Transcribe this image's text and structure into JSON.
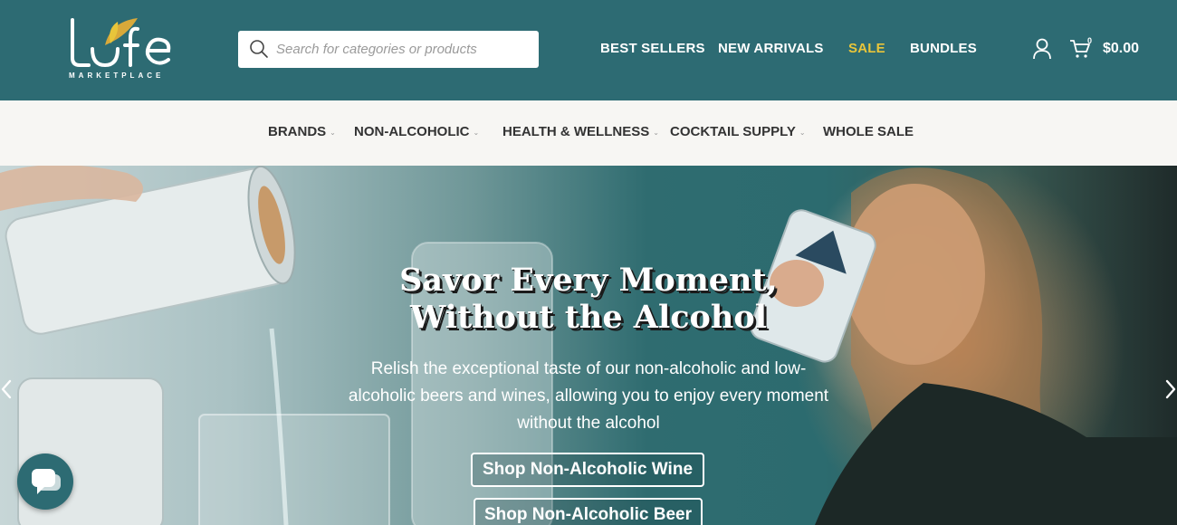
{
  "brand": {
    "logo_text": "MARKETPLACE",
    "colors": {
      "header_bg": "#2d6b73",
      "sale": "#e8c53a",
      "logo_gold": "#d9a93a"
    }
  },
  "search": {
    "placeholder": "Search for categories or products"
  },
  "main_nav": [
    {
      "label": "BEST SELLERS"
    },
    {
      "label": "NEW ARRIVALS"
    },
    {
      "label": "SALE"
    },
    {
      "label": "BUNDLES"
    }
  ],
  "cart": {
    "count": "0",
    "total": "$0.00"
  },
  "categories": [
    {
      "label": "BRANDS"
    },
    {
      "label": "NON-ALCOHOLIC"
    },
    {
      "label": "HEALTH & WELLNESS"
    },
    {
      "label": "COCKTAIL SUPPLY"
    },
    {
      "label": "WHOLE SALE"
    }
  ],
  "hero": {
    "title_line1": "Savor Every Moment,",
    "title_line2": "Without the Alcohol",
    "subtitle": "Relish the exceptional taste of our non-alcoholic and low-alcoholic beers and wines, allowing you to enjoy every moment without the alcohol",
    "cta_wine": "Shop Non-Alcoholic Wine",
    "cta_beer": "Shop Non-Alcoholic Beer"
  },
  "icons": {
    "search": "search-icon",
    "user": "user-icon",
    "cart": "cart-icon",
    "prev": "chevron-left-icon",
    "next": "chevron-right-icon",
    "chat": "chat-icon"
  }
}
